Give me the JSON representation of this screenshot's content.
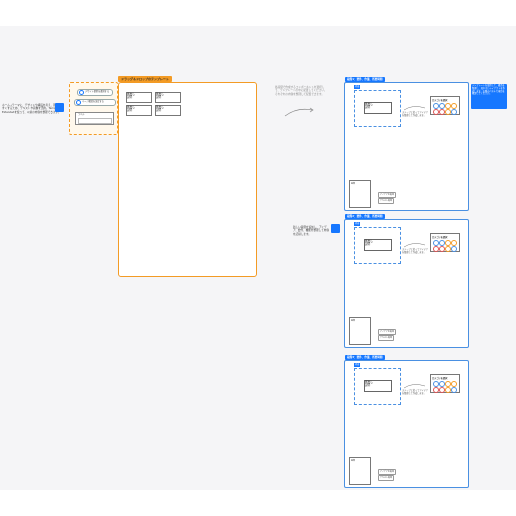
{
  "left_note": "ホーム→テーマに、デザインや構造を考え、理解しやすくするため、テキストや画像を活用。TemplateとExtendedを使って、以前の内容を整理できます。",
  "drag_source": {
    "pill1": "デザイン要素を選択する",
    "pill2": "ページ構造を決定する",
    "input_label": "ラベル"
  },
  "template": {
    "title": "ドラッグ＆ドロップのテンプレート",
    "cards": [
      {
        "title": "見出し",
        "sub": "説明"
      },
      {
        "title": "見出し",
        "sub": "説明"
      },
      {
        "title": "見出し",
        "sub": "説明"
      },
      {
        "title": "見出し",
        "sub": "説明"
      }
    ]
  },
  "mid_note": "各段階で作成するコンポーネントを選択して、テンプレートの中に配置してください。それぞれの内容を整理して配置できます。",
  "tip": "テンプレートを使用して、構造を整理し、見やすいレイアウトを作成します。右側のパネルで項目を確認してください。",
  "middle_callout": "新しい段階を追加し、アイデア、要件、機能を整理して内容を記録します。",
  "sections": [
    {
      "title": "段階1：要件、作業、所要時間",
      "tag": "内容",
      "card_title": "見出し",
      "card_sub": "説明",
      "flow_text": "ステップに従ってアイデアを整理して作成します。",
      "palette_title": "カテゴリを選択",
      "thumb_caption": "画像",
      "btn1": "アイデアを追加",
      "btn2": "テキスト追加"
    },
    {
      "title": "段階2：要件、作業、所要時間",
      "tag": "内容",
      "card_title": "見出し",
      "card_sub": "説明",
      "flow_text": "ステップに従ってアイデアを整理して作成します。",
      "palette_title": "カテゴリを選択",
      "thumb_caption": "画像",
      "btn1": "アイデアを追加",
      "btn2": "テキスト追加"
    },
    {
      "title": "段階3：要件、作業、所要時間",
      "tag": "内容",
      "card_title": "見出し",
      "card_sub": "説明",
      "flow_text": "ステップに従ってアイデアを整理して作成します。",
      "palette_title": "カテゴリを選択",
      "thumb_caption": "画像",
      "btn1": "アイデアを追加",
      "btn2": "テキスト追加"
    }
  ],
  "colors": {
    "accent_blue": "#1677ff",
    "accent_orange": "#f39b25",
    "palette": [
      "#4a90e2",
      "#4a90e2",
      "#f39b25",
      "#f39b25",
      "#e05555",
      "#e05555",
      "#f39b25",
      "#4a90e2"
    ]
  }
}
